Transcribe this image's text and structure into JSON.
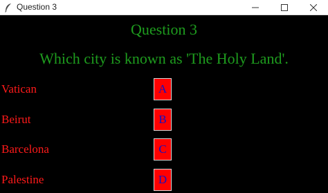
{
  "window": {
    "title": "Question 3",
    "icon": "feather-icon"
  },
  "quiz": {
    "heading": "Question 3",
    "question": "Which city is known as 'The Holy Land'.",
    "options": [
      {
        "label": "Vatican",
        "button": "A"
      },
      {
        "label": "Beirut",
        "button": "B"
      },
      {
        "label": "Barcelona",
        "button": "C"
      },
      {
        "label": "Palestine",
        "button": "D"
      }
    ]
  },
  "colors": {
    "background": "#000000",
    "heading_text": "#1e9c1e",
    "option_text": "#ff1a1a",
    "button_fill": "#ff0000",
    "button_text": "#1010c8"
  }
}
